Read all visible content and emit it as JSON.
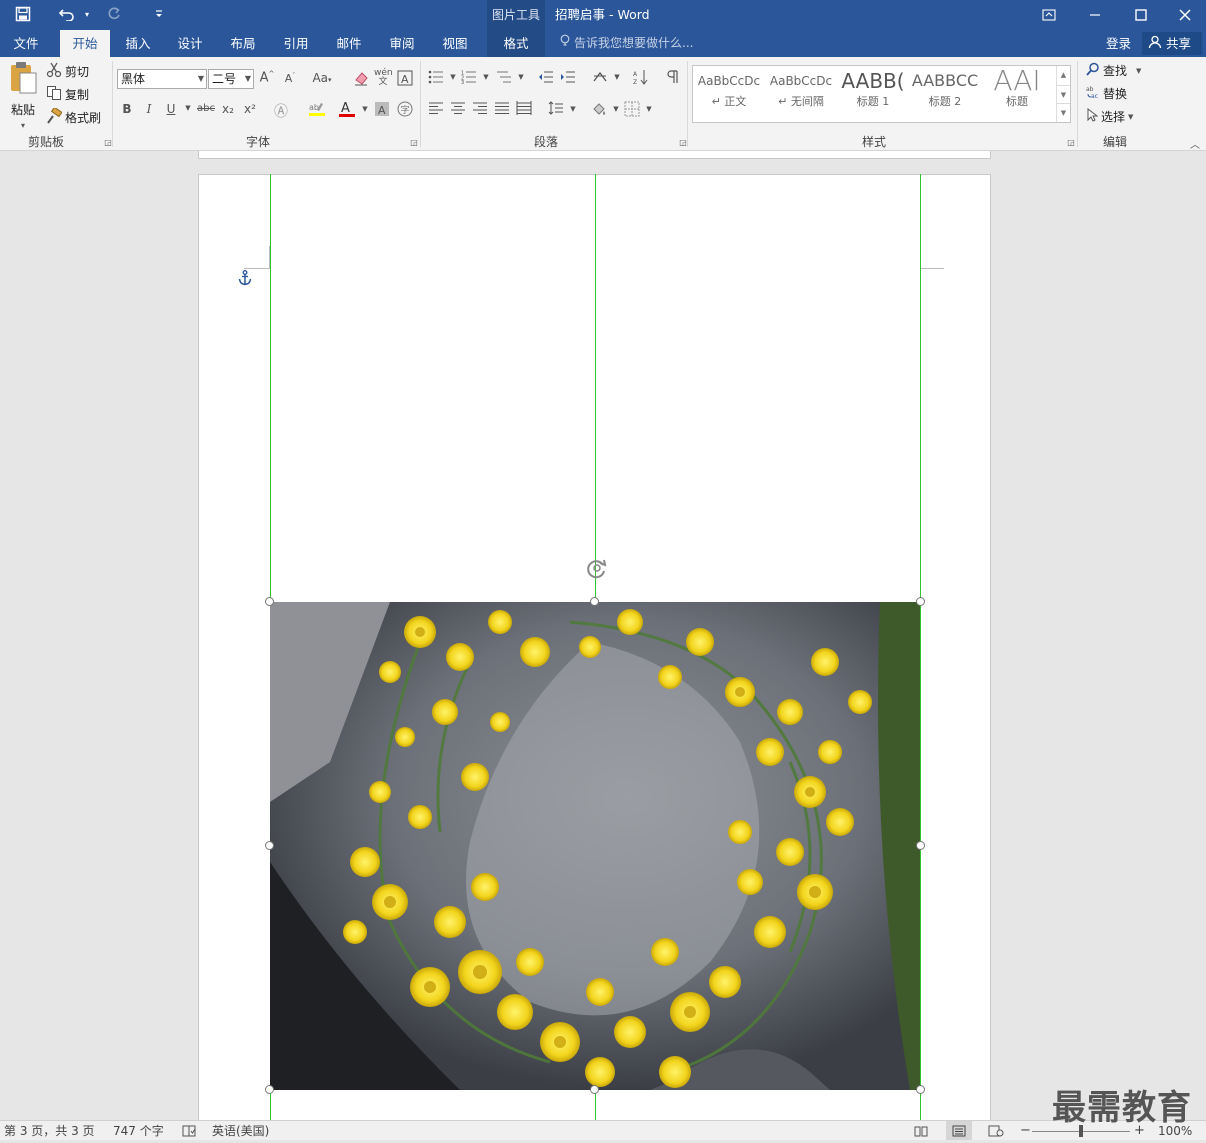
{
  "titlebar": {
    "context_tool": "图片工具",
    "document_title": "招聘启事 - Word",
    "save_icon": "save-icon",
    "undo_icon": "undo-icon",
    "redo_icon": "redo-icon",
    "customize_icon": "customize-qat-icon",
    "accent_color": "#2b579a"
  },
  "tabs": {
    "file": "文件",
    "home": "开始",
    "insert": "插入",
    "design": "设计",
    "layout": "布局",
    "references": "引用",
    "mailings": "邮件",
    "review": "审阅",
    "view": "视图",
    "format": "格式",
    "tell_me": "告诉我您想要做什么...",
    "login": "登录",
    "share": "共享"
  },
  "ribbon": {
    "clipboard": {
      "paste": "粘贴",
      "cut": "剪切",
      "copy": "复制",
      "format_painter": "格式刷",
      "label": "剪贴板"
    },
    "font": {
      "font_name": "黑体",
      "font_size": "二号",
      "label": "字体",
      "change_case": "Aa",
      "bold": "B",
      "italic": "I",
      "underline": "U",
      "strikethrough": "abc",
      "subscript": "x₂",
      "superscript": "x²",
      "font_color_letter": "A",
      "font_color": "#e00000",
      "highlight_color": "#ffff00"
    },
    "paragraph": {
      "label": "段落"
    },
    "styles": {
      "label": "样式",
      "items": [
        {
          "preview": "AaBbCcDc",
          "name": "↵ 正文"
        },
        {
          "preview": "AaBbCcDc",
          "name": "↵ 无间隔"
        },
        {
          "preview": "AABB(",
          "name": "标题 1"
        },
        {
          "preview": "AABBCC",
          "name": "标题 2"
        },
        {
          "preview": "AAI",
          "name": "标题"
        }
      ]
    },
    "editing": {
      "find": "查找",
      "replace": "替换",
      "select": "选择",
      "label": "编辑"
    }
  },
  "status": {
    "page": "第 3 页，共 3 页",
    "words": "747 个字",
    "language": "英语(美国)",
    "zoom": "100%"
  },
  "watermark": "最需教育"
}
